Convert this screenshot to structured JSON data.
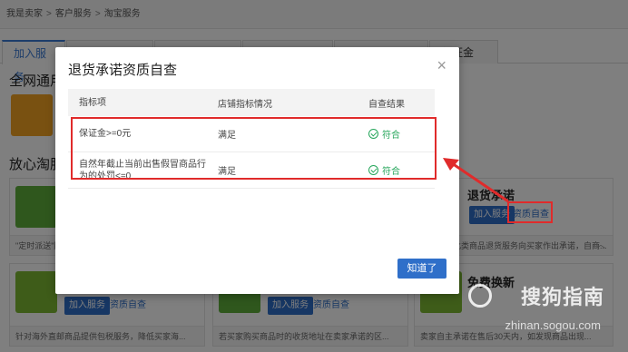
{
  "breadcrumb": [
    "我是卖家",
    "客户服务",
    "淘宝服务"
  ],
  "tabs": [
    "加入服务",
    "",
    "",
    "",
    "",
    "保证金"
  ],
  "sections": {
    "all_network": "全网通用",
    "peace_of_mind": "放心淘服"
  },
  "cards": {
    "return_promise": {
      "title": "退货承诺",
      "join": "加入服务",
      "check": "资质自查",
      "foot": "卖家承诺此类商品退货服务向买家作出承诺，自商..."
    },
    "bottom_left": {
      "join": "加入服务",
      "check": "资质自查",
      "foot": "针对海外直邮商品提供包税服务，降低买家海..."
    },
    "bottom_mid": {
      "join": "加入服务",
      "check": "资质自查",
      "foot": "若买家购买商品时的收货地址在卖家承诺的区..."
    },
    "bottom_right": {
      "title": "免费换新",
      "foot": "卖家自主承诺在售后30天内，如发现商品出现..."
    },
    "mid_left_foot": "\"定时派送\"服务..."
  },
  "modal": {
    "title": "退货承诺资质自查",
    "close": "×",
    "headers": [
      "指标项",
      "店铺指标情况",
      "自查结果"
    ],
    "rows": [
      {
        "item": "保证金>=0元",
        "status": "满足",
        "result": "符合"
      },
      {
        "item": "自然年截止当前出售假冒商品行为的处罚<=0",
        "status": "满足",
        "result": "符合"
      }
    ],
    "ok": "知道了"
  },
  "watermark": {
    "brand": "搜狗指南",
    "url": "zhinan.sogou.com"
  },
  "colors": {
    "accent": "#2f6fc9",
    "pass": "#26a65b",
    "annotation": "#e02b2b"
  }
}
